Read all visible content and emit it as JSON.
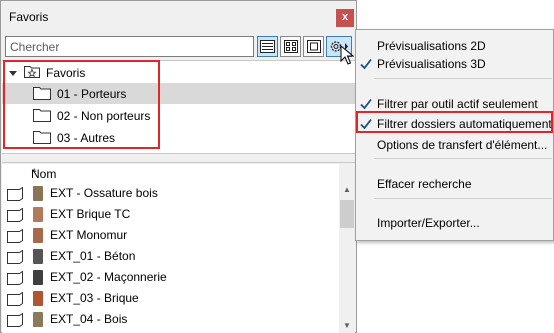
{
  "palette": {
    "title": "Favoris",
    "close_label": "x",
    "search_placeholder": "Chercher"
  },
  "tree": {
    "root": "Favoris",
    "folders": [
      {
        "label": "01 - Porteurs",
        "selected": true
      },
      {
        "label": "02 - Non porteurs",
        "selected": false
      },
      {
        "label": "03 - Autres",
        "selected": false
      }
    ]
  },
  "list": {
    "column_header": "Nom",
    "items": [
      {
        "label": "EXT - Ossature bois",
        "swatch": "#8b7355"
      },
      {
        "label": "EXT Brique TC",
        "swatch": "#b07a5e"
      },
      {
        "label": "EXT Monomur",
        "swatch": "#a56a4b"
      },
      {
        "label": "EXT_01 - Béton",
        "swatch": "#555555"
      },
      {
        "label": "EXT_02 - Maçonnerie",
        "swatch": "#3f3f3f"
      },
      {
        "label": "EXT_03 - Brique",
        "swatch": "#b0552e"
      },
      {
        "label": "EXT_04 - Bois",
        "swatch": "#8a7a5a"
      }
    ]
  },
  "menu": {
    "items": [
      {
        "label": "Prévisualisations 2D",
        "checked": false
      },
      {
        "label": "Prévisualisations 3D",
        "checked": true
      },
      {
        "label": "Filtrer par outil actif seulement",
        "checked": true
      },
      {
        "label": "Filtrer dossiers automatiquement",
        "checked": true
      },
      {
        "label": "Options de transfert d'élément...",
        "checked": false
      },
      {
        "label": "Effacer recherche",
        "checked": false
      },
      {
        "label": "Importer/Exporter...",
        "checked": false
      }
    ]
  },
  "colors": {
    "highlight_border": "#e0262b",
    "selected_row": "#d9d9d9",
    "active_button": "#cce4f7",
    "check_mark": "#1a4f8a"
  }
}
